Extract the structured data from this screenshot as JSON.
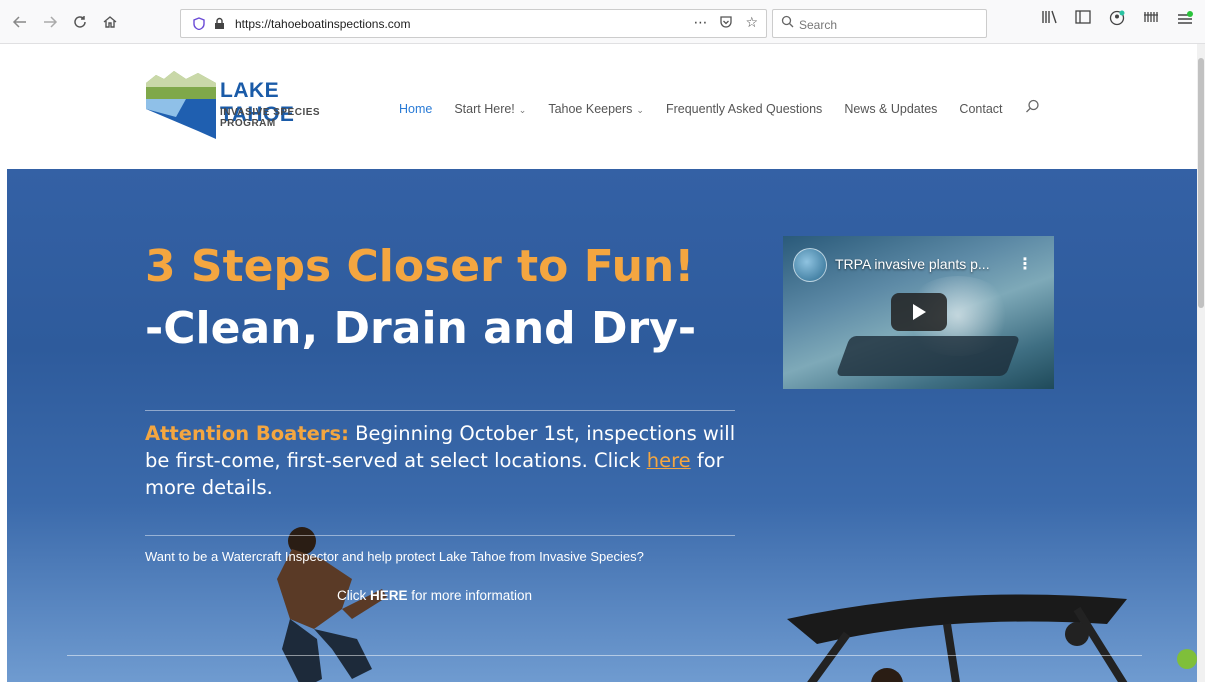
{
  "browser": {
    "url": "https://tahoeboatinspections.com",
    "search_placeholder": "Search",
    "nav_icons": [
      "back-icon",
      "forward-icon",
      "reload-icon",
      "home-icon"
    ],
    "toolbar_icons": [
      "library-icon",
      "sidebar-icon",
      "account-icon",
      "extension-icon",
      "menu-icon"
    ]
  },
  "logo": {
    "title": "LAKE TAHOE",
    "subtitle": "INVASIVE SPECIES PROGRAM"
  },
  "nav": {
    "items": [
      {
        "label": "Home",
        "active": true
      },
      {
        "label": "Start Here!",
        "dropdown": true
      },
      {
        "label": "Tahoe Keepers",
        "dropdown": true
      },
      {
        "label": "Frequently Asked Questions"
      },
      {
        "label": "News & Updates"
      },
      {
        "label": "Contact"
      }
    ]
  },
  "hero": {
    "headline": "3 Steps Closer to Fun!",
    "subheadline": "-Clean, Drain and Dry-",
    "attention_label": "Attention Boaters:",
    "attention_text_1": " Beginning October 1st, inspections will be first-come, first-served at select locations. Click ",
    "attention_link": "here",
    "attention_text_2": " for more details.",
    "inspector_text": "Want to be a Watercraft Inspector and help protect Lake Tahoe from Invasive Species?",
    "more_info_prefix": "Click ",
    "more_info_bold": "HERE",
    "more_info_suffix": " for more information"
  },
  "video": {
    "title": "TRPA invasive plants p..."
  },
  "colors": {
    "accent_orange": "#f4a640",
    "nav_active": "#2a7bd6",
    "logo_blue": "#1a5ba8",
    "hero_blue": "#3461a5"
  }
}
